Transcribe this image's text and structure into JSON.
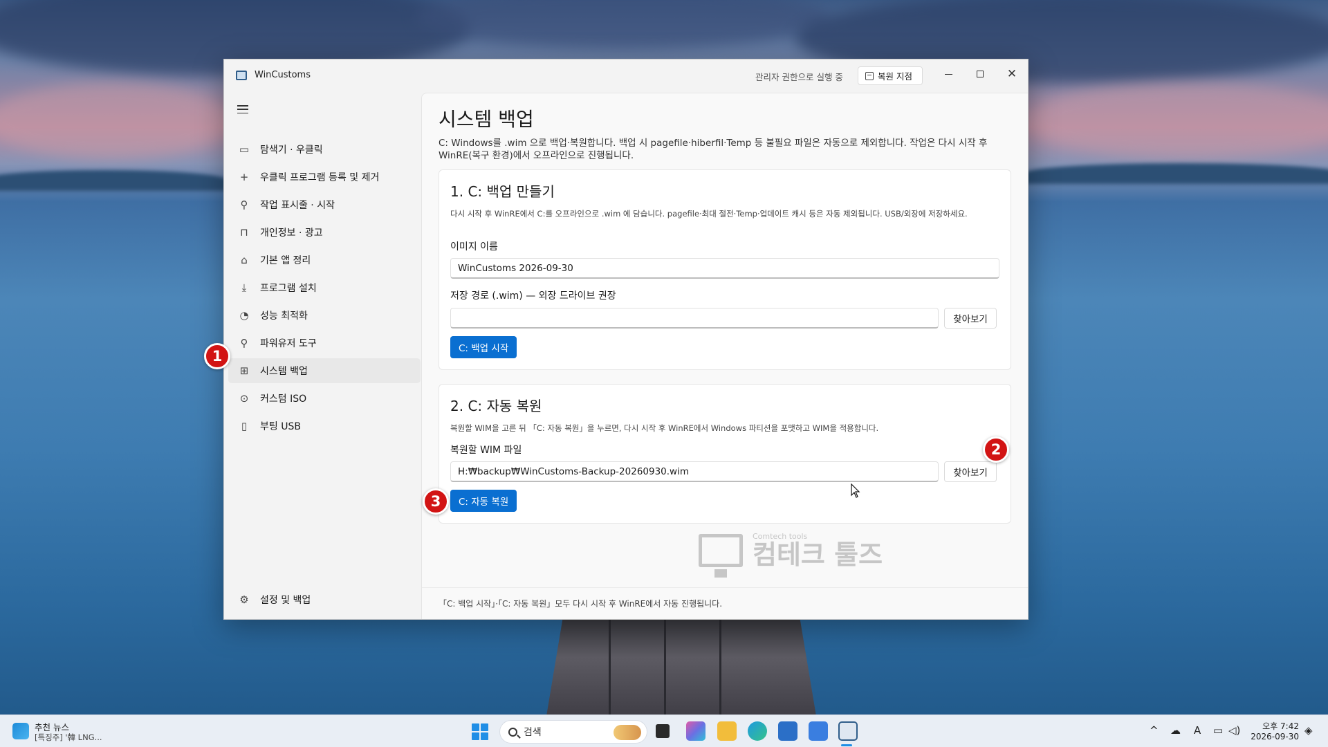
{
  "window": {
    "title": "WinCustoms",
    "admin_status": "관리자 권한으로 실행 중",
    "restore_point_label": "복원 지점"
  },
  "sidebar": {
    "items": [
      {
        "label": "탐색기 · 우클릭",
        "icon": "folder-icon"
      },
      {
        "label": "우클릭 프로그램 등록 및 제거",
        "icon": "plus-icon"
      },
      {
        "label": "작업 표시줄 · 시작",
        "icon": "wrench-icon"
      },
      {
        "label": "개인정보 · 광고",
        "icon": "lock-icon"
      },
      {
        "label": "기본 앱 정리",
        "icon": "trash-icon"
      },
      {
        "label": "프로그램 설치",
        "icon": "download-icon"
      },
      {
        "label": "성능 최적화",
        "icon": "gauge-icon"
      },
      {
        "label": "파워유저 도구",
        "icon": "wrench-icon"
      },
      {
        "label": "시스템 백업",
        "icon": "grid-icon",
        "active": true
      },
      {
        "label": "커스텀 ISO",
        "icon": "disc-icon"
      },
      {
        "label": "부팅 USB",
        "icon": "usb-icon"
      }
    ],
    "settings_label": "설정 및 백업"
  },
  "main": {
    "title": "시스템 백업",
    "description": "C: Windows를 .wim 으로 백업·복원합니다. 백업 시 pagefile·hiberfil·Temp 등 불필요 파일은 자동으로 제외합니다. 작업은 다시 시작 후 WinRE(복구 환경)에서 오프라인으로 진행됩니다.",
    "backup_card": {
      "title": "1. C: 백업 만들기",
      "description": "다시 시작 후 WinRE에서 C:를 오프라인으로 .wim 에 담습니다. pagefile·최대 절전·Temp·업데이트 캐시 등은 자동 제외됩니다. USB/외장에 저장하세요.",
      "image_name_label": "이미지 이름",
      "image_name_value": "WinCustoms 2026-09-30",
      "save_path_label": "저장 경로 (.wim) — 외장 드라이브 권장",
      "save_path_value": "",
      "browse_label": "찾아보기",
      "start_label": "C: 백업 시작"
    },
    "restore_card": {
      "title": "2. C: 자동 복원",
      "description": "복원할 WIM을 고른 뒤 「C: 자동 복원」을 누르면, 다시 시작 후 WinRE에서 Windows 파티션을 포맷하고 WIM을 적용합니다.",
      "wim_file_label": "복원할 WIM 파일",
      "wim_file_value": "H:₩backup₩WinCustoms-Backup-20260930.wim",
      "browse_label": "찾아보기",
      "restore_label": "C: 자동 복원"
    },
    "footer_note": "「C: 백업 시작」·「C: 자동 복원」모두 다시 시작 후 WinRE에서 자동 진행됩니다.",
    "watermark": {
      "small": "Comtech tools",
      "big": "컴테크 툴즈"
    }
  },
  "markers": [
    "1",
    "2",
    "3"
  ],
  "taskbar": {
    "news_title": "추천 뉴스",
    "news_subtitle": "[특징주] '韓 LNG...",
    "search_placeholder": "검색",
    "time": "오후 7:42",
    "date": "2026-09-30"
  },
  "colors": {
    "accent": "#0a6fd1",
    "marker": "#d21414",
    "active_nav": "#e8e8e8"
  }
}
